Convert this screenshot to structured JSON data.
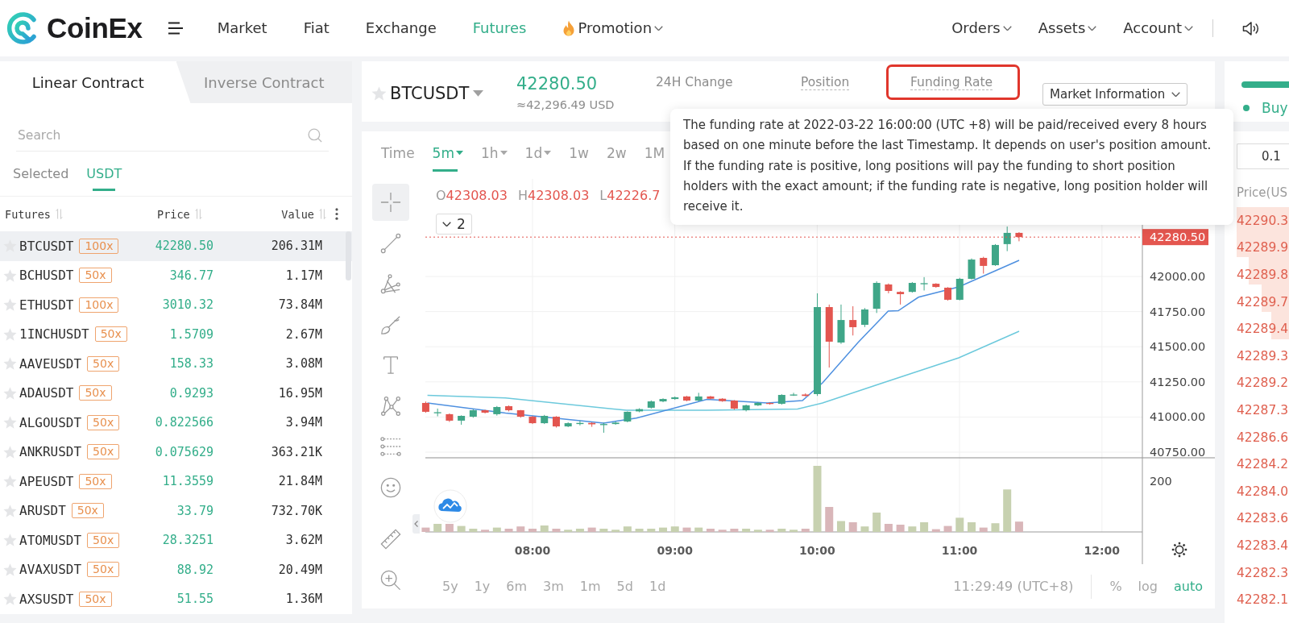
{
  "nav": {
    "logo": "CoinEx",
    "items": [
      {
        "label": "Market",
        "kind": "link",
        "selected": false
      },
      {
        "label": "Fiat",
        "kind": "link",
        "selected": false
      },
      {
        "label": "Exchange",
        "kind": "link",
        "selected": false
      },
      {
        "label": "Futures",
        "kind": "link",
        "selected": true
      },
      {
        "label": "Promotion",
        "kind": "promo",
        "selected": false
      }
    ],
    "account_menu": [
      {
        "label": "Orders",
        "kind": "menu"
      },
      {
        "label": "Assets",
        "kind": "menu"
      },
      {
        "label": "Account",
        "kind": "menu"
      }
    ]
  },
  "market_list": {
    "tabs": [
      {
        "label": "Linear Contract",
        "selected": true
      },
      {
        "label": "Inverse Contract",
        "selected": false
      }
    ],
    "search": {
      "placeholder": "Search"
    },
    "filters": [
      {
        "label": "Selected",
        "selected": false
      },
      {
        "label": "USDT",
        "selected": true
      }
    ],
    "columns": [
      "Futures",
      "Price",
      "Value"
    ],
    "rows": [
      {
        "symbol": "BTCUSDT",
        "leverage": "100x",
        "price": "42280.50",
        "value": "206.31M",
        "favorite": false,
        "selected": true
      },
      {
        "symbol": "BCHUSDT",
        "leverage": "50x",
        "price": "346.77",
        "value": "1.17M",
        "favorite": false,
        "selected": false
      },
      {
        "symbol": "ETHUSDT",
        "leverage": "100x",
        "price": "3010.32",
        "value": "73.84M",
        "favorite": false,
        "selected": false
      },
      {
        "symbol": "1INCHUSDT",
        "leverage": "50x",
        "price": "1.5709",
        "value": "2.67M",
        "favorite": false,
        "selected": false
      },
      {
        "symbol": "AAVEUSDT",
        "leverage": "50x",
        "price": "158.33",
        "value": "3.08M",
        "favorite": false,
        "selected": false
      },
      {
        "symbol": "ADAUSDT",
        "leverage": "50x",
        "price": "0.9293",
        "value": "16.95M",
        "favorite": false,
        "selected": false
      },
      {
        "symbol": "ALGOUSDT",
        "leverage": "50x",
        "price": "0.822566",
        "value": "3.94M",
        "favorite": false,
        "selected": false
      },
      {
        "symbol": "ANKRUSDT",
        "leverage": "50x",
        "price": "0.075629",
        "value": "363.21K",
        "favorite": false,
        "selected": false
      },
      {
        "symbol": "APEUSDT",
        "leverage": "50x",
        "price": "11.3559",
        "value": "21.84M",
        "favorite": false,
        "selected": false
      },
      {
        "symbol": "ARUSDT",
        "leverage": "50x",
        "price": "33.79",
        "value": "732.70K",
        "favorite": false,
        "selected": false
      },
      {
        "symbol": "ATOMUSDT",
        "leverage": "50x",
        "price": "28.3251",
        "value": "3.62M",
        "favorite": false,
        "selected": false
      },
      {
        "symbol": "AVAXUSDT",
        "leverage": "50x",
        "price": "88.92",
        "value": "20.49M",
        "favorite": false,
        "selected": false
      },
      {
        "symbol": "AXSUSDT",
        "leverage": "50x",
        "price": "51.55",
        "value": "1.36M",
        "favorite": false,
        "selected": false
      }
    ]
  },
  "ticker": {
    "symbol": "BTCUSDT",
    "favorite": false,
    "price": "42280.50",
    "price_usd": "≈42,296.49 USD",
    "stats": [
      {
        "label": "24H Change",
        "kind": "plain",
        "highlighted": false
      },
      {
        "label": "Position",
        "kind": "hint",
        "highlighted": false
      },
      {
        "label": "Funding Rate",
        "kind": "hint",
        "highlighted": true
      }
    ],
    "market_info": "Market Information"
  },
  "tooltip": {
    "text": "The funding rate at 2022-03-22 16:00:00 (UTC +8) will be paid/received every 8 hours based on one minute before the last Timestamp. It depends on user's position amount. If the funding rate is positive, long positions will pay the funding to short position holders with the exact amount; if the funding rate is negative, long position holder will receive it."
  },
  "chart": {
    "intervals": [
      {
        "label": "Time",
        "selected": false,
        "dropdown": false
      },
      {
        "label": "5m",
        "selected": true,
        "dropdown": true
      },
      {
        "label": "1h",
        "selected": false,
        "dropdown": true
      },
      {
        "label": "1d",
        "selected": false,
        "dropdown": true
      },
      {
        "label": "1w",
        "selected": false,
        "dropdown": false
      },
      {
        "label": "2w",
        "selected": false,
        "dropdown": false
      },
      {
        "label": "1M",
        "selected": false,
        "dropdown": false
      }
    ],
    "drawing_tools": [
      {
        "kind": "crosshair",
        "selected": true
      },
      {
        "kind": "trend-line",
        "selected": false
      },
      {
        "kind": "fork",
        "selected": false
      },
      {
        "kind": "brush",
        "selected": false
      },
      {
        "kind": "text",
        "selected": false
      },
      {
        "kind": "pattern",
        "selected": false
      },
      {
        "kind": "levels",
        "selected": false
      },
      {
        "kind": "emoji",
        "selected": false
      }
    ],
    "utility_tools": [
      {
        "kind": "ruler",
        "selected": false
      },
      {
        "kind": "zoom",
        "selected": false
      }
    ],
    "legend": [
      {
        "label": "O",
        "value": "42308.03"
      },
      {
        "label": "H",
        "value": "42308.03"
      },
      {
        "label": "L",
        "value": "42226.7"
      }
    ],
    "indicator_count": "2",
    "last_price": "42280.50",
    "price_axis": [
      "42000.00",
      "41750.00",
      "41500.00",
      "41250.00",
      "41000.00",
      "40750.00"
    ],
    "volume_axis": [
      "200"
    ],
    "time_axis": [
      "08:00",
      "09:00",
      "10:00",
      "11:00",
      "12:00"
    ],
    "ranges": [
      {
        "label": "5y",
        "selected": false
      },
      {
        "label": "1y",
        "selected": false
      },
      {
        "label": "6m",
        "selected": false
      },
      {
        "label": "3m",
        "selected": false
      },
      {
        "label": "1m",
        "selected": false
      },
      {
        "label": "5d",
        "selected": false
      },
      {
        "label": "1d",
        "selected": false
      }
    ],
    "clock": "11:29:49 (UTC+8)",
    "scales": [
      {
        "label": "%",
        "selected": false
      },
      {
        "label": "log",
        "selected": false
      },
      {
        "label": "auto",
        "selected": true
      }
    ]
  },
  "order_book": {
    "side": "Buy",
    "precision": "0.1",
    "price_header": "Price(US",
    "asks": [
      "42290.3",
      "42289.9",
      "42289.8",
      "42289.7",
      "42289.4",
      "42289.3",
      "42289.2",
      "42287.3",
      "42286.6",
      "42284.2",
      "42284.0",
      "42283.6",
      "42283.4",
      "42282.3",
      "42282.1"
    ]
  }
}
